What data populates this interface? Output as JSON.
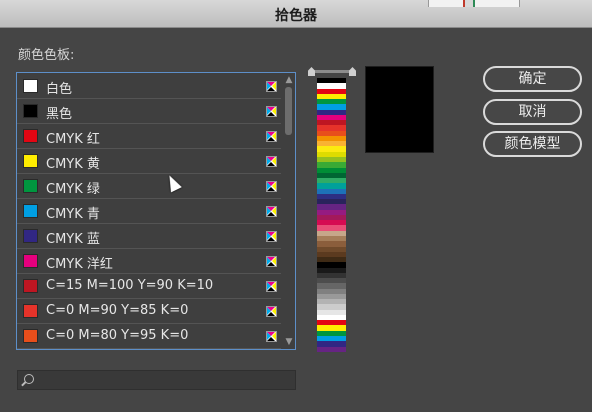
{
  "window": {
    "title": "拾色器"
  },
  "swatches": {
    "label": "颜色色板:",
    "items": [
      {
        "name": "白色",
        "color": "#ffffff"
      },
      {
        "name": "黑色",
        "color": "#000000"
      },
      {
        "name": "CMYK 红",
        "color": "#e30613"
      },
      {
        "name": "CMYK 黄",
        "color": "#ffed00"
      },
      {
        "name": "CMYK 绿",
        "color": "#00963f"
      },
      {
        "name": "CMYK 青",
        "color": "#009fe3"
      },
      {
        "name": "CMYK 蓝",
        "color": "#312783"
      },
      {
        "name": "CMYK 洋红",
        "color": "#e6007e"
      },
      {
        "name": "C=15 M=100 Y=90 K=10",
        "color": "#be1622"
      },
      {
        "name": "C=0 M=90 Y=85 K=0",
        "color": "#e6332a"
      },
      {
        "name": "C=0 M=80 Y=95 K=0",
        "color": "#e84e1b"
      }
    ]
  },
  "search": {
    "value": "",
    "placeholder": ""
  },
  "preview": {
    "color": "#000000"
  },
  "buttons": {
    "ok": "确定",
    "cancel": "取消",
    "color_model": "颜色模型"
  },
  "ramp_colors": [
    "#000000",
    "#ffffff",
    "#e30613",
    "#ffed00",
    "#00963f",
    "#009fe3",
    "#312783",
    "#e6007e",
    "#be1622",
    "#e6332a",
    "#e84e1b",
    "#f39200",
    "#f9b233",
    "#fcea10",
    "#dedc00",
    "#95c11f",
    "#3aaa35",
    "#008d36",
    "#006633",
    "#2fac66",
    "#00a19a",
    "#1d71b8",
    "#2d2e83",
    "#29235c",
    "#662483",
    "#951b81",
    "#a3195b",
    "#d60b52",
    "#e94e77",
    "#c6a78a",
    "#a57e5a",
    "#8b5e3c",
    "#6f4a2b",
    "#5b3a1f",
    "#3e2a15",
    "#000000",
    "#1a1a1a",
    "#333333",
    "#4d4d4d",
    "#666666",
    "#808080",
    "#999999",
    "#b3b3b3",
    "#cccccc",
    "#e6e6e6",
    "#ffffff",
    "#e30613",
    "#ffed00",
    "#00963f",
    "#009fe3",
    "#312783",
    "#662483"
  ]
}
